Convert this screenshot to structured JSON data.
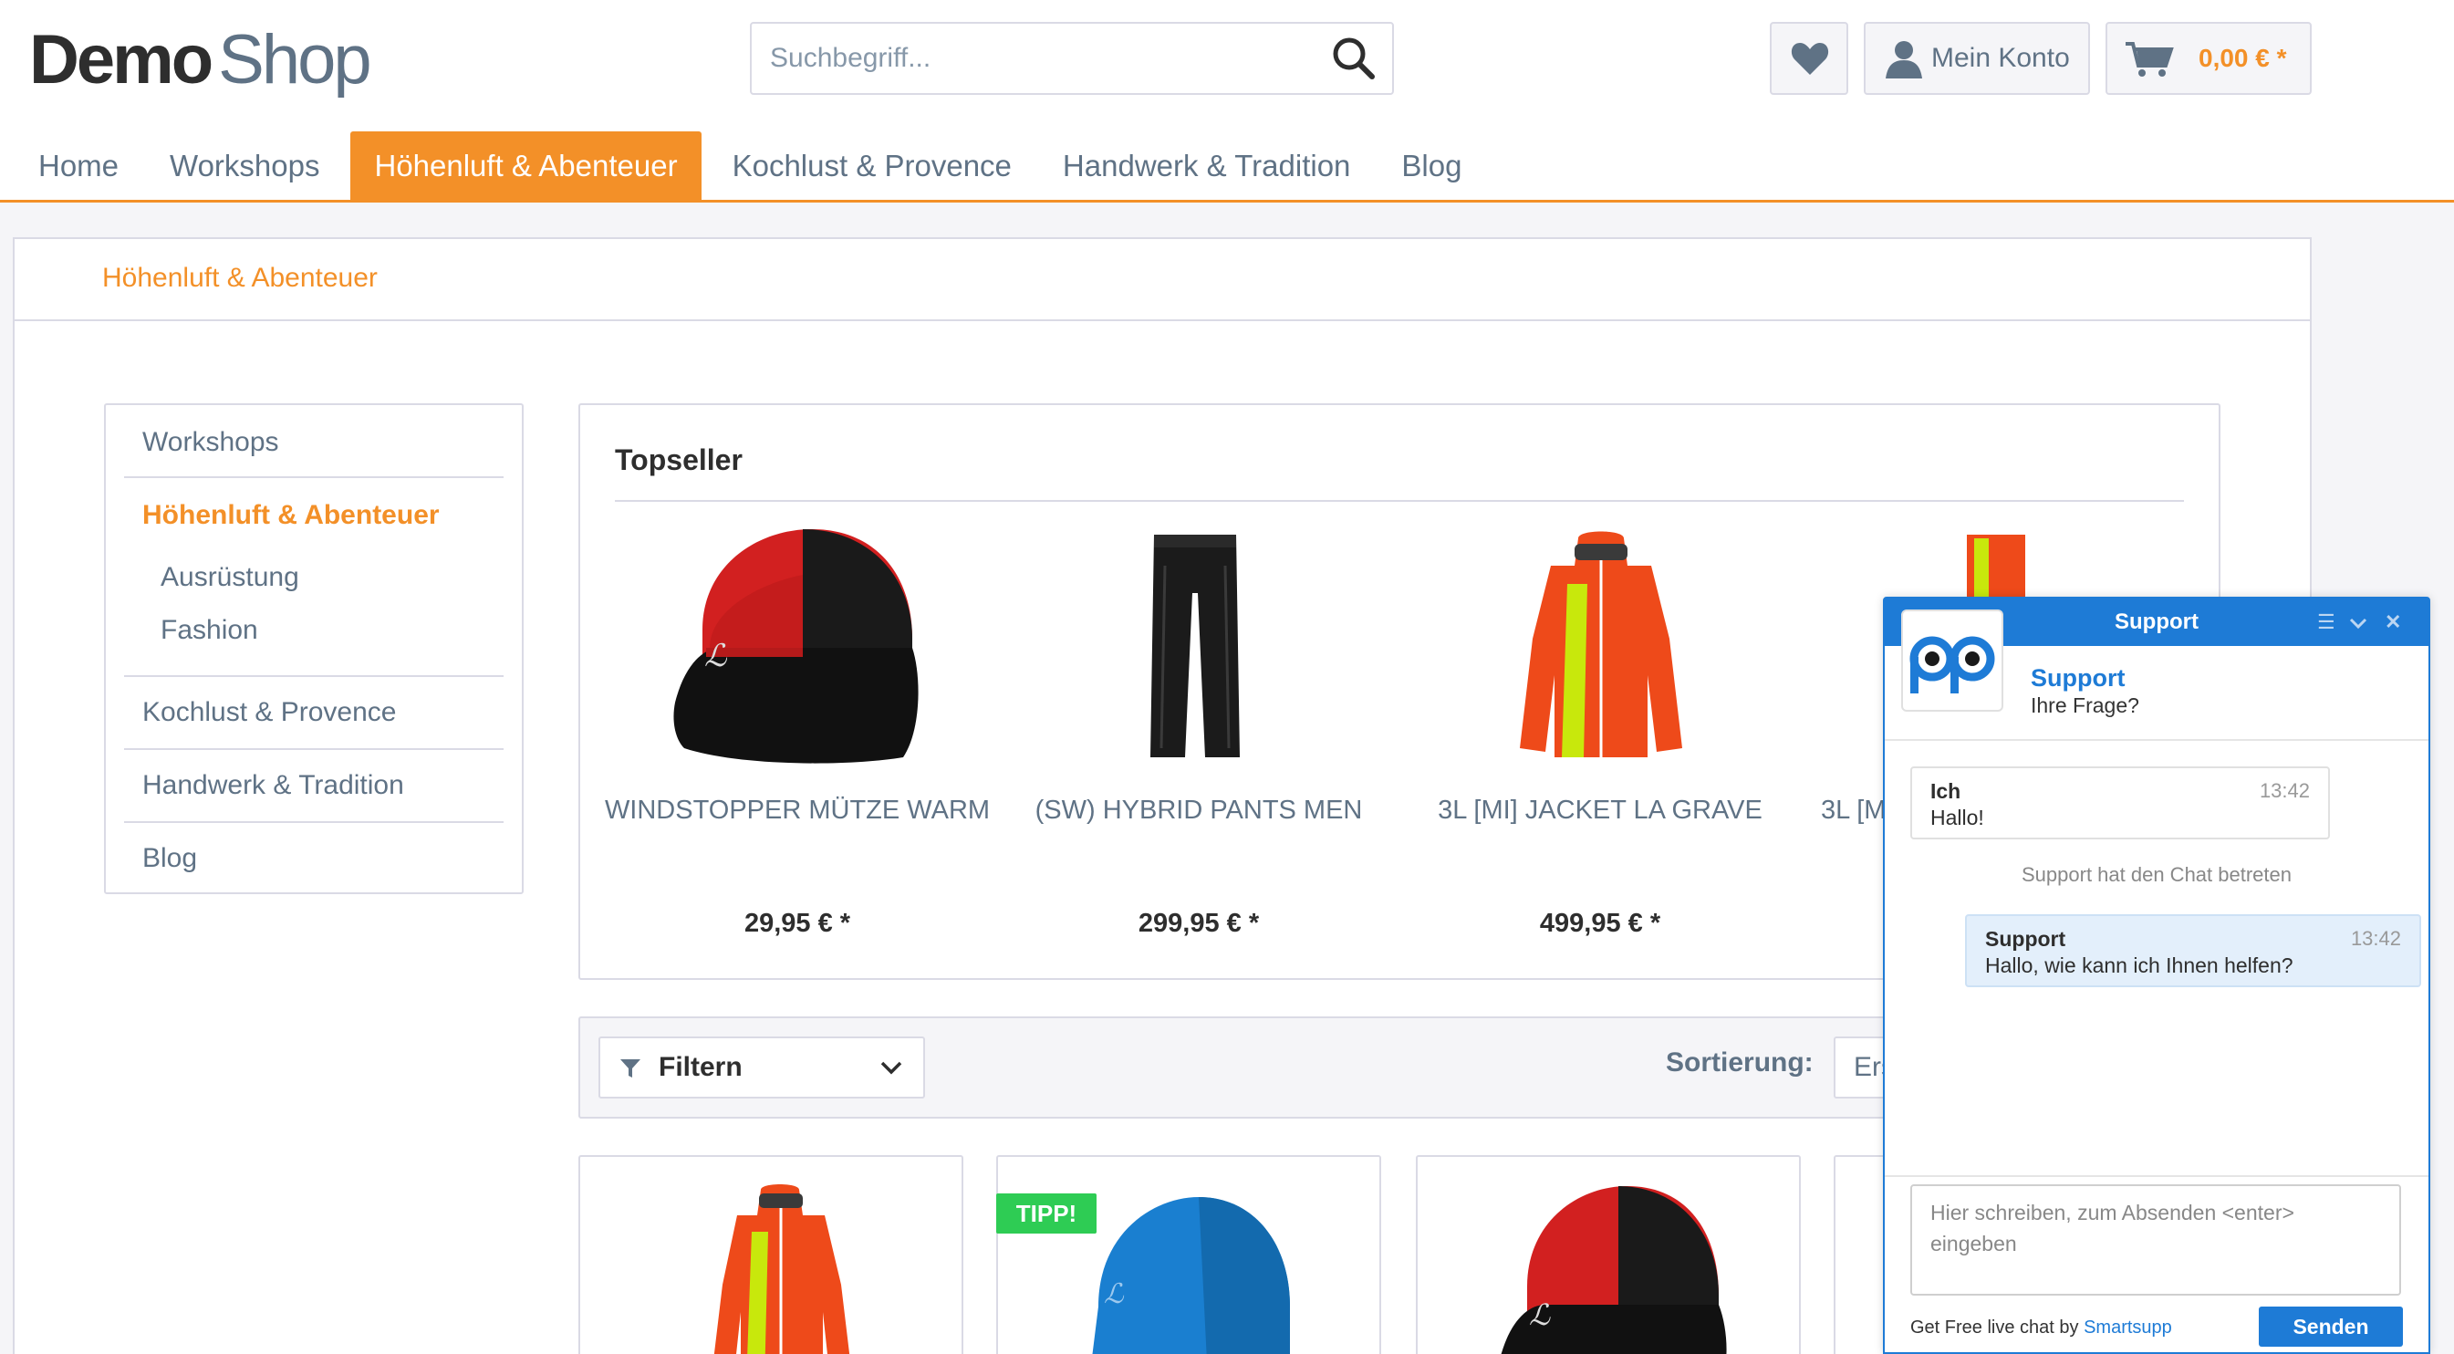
{
  "header": {
    "logo_demo": "Demo",
    "logo_shop": "Shop",
    "search_placeholder": "Suchbegriff...",
    "account_label": "Mein Konto",
    "cart_label": "0,00 € *"
  },
  "nav": [
    {
      "label": "Home"
    },
    {
      "label": "Workshops"
    },
    {
      "label": "Höhenluft & Abenteuer",
      "active": true
    },
    {
      "label": "Kochlust & Provence"
    },
    {
      "label": "Handwerk & Tradition"
    },
    {
      "label": "Blog"
    }
  ],
  "breadcrumb": "Höhenluft & Abenteuer",
  "sidebar": {
    "items": [
      {
        "label": "Workshops"
      },
      {
        "label": "Höhenluft & Abenteuer",
        "active": true
      },
      {
        "label": "Ausrüstung"
      },
      {
        "label": "Fashion"
      },
      {
        "label": "Kochlust & Provence"
      },
      {
        "label": "Handwerk & Tradition"
      },
      {
        "label": "Blog"
      }
    ]
  },
  "topseller": {
    "title": "Topseller",
    "products": [
      {
        "name": "WINDSTOPPER MÜTZE WARM",
        "price": "29,95 € *"
      },
      {
        "name": "(SW) HYBRID PANTS MEN",
        "price": "299,95 € *"
      },
      {
        "name": "3L [MI] JACKET LA GRAVE",
        "price": "499,95 € *"
      },
      {
        "name": "3L [M",
        "price": ""
      }
    ]
  },
  "listing": {
    "filter_label": "Filtern",
    "sort_label": "Sortierung:",
    "sort_value": "Ers",
    "tipp_badge": "TIPP!"
  },
  "chat": {
    "title": "Support",
    "agent_name": "Support",
    "agent_subtitle": "Ihre Frage?",
    "messages": [
      {
        "who": "Ich",
        "text": "Hallo!",
        "time": "13:42"
      },
      {
        "who": "Support",
        "text": "Hallo, wie kann ich Ihnen helfen?",
        "time": "13:42"
      }
    ],
    "join_notice": "Support hat den Chat betreten",
    "input_placeholder": "Hier schreiben, zum Absenden <enter> eingeben",
    "powered_prefix": "Get Free live chat by ",
    "powered_link": "Smartsupp",
    "send_label": "Senden"
  },
  "colors": {
    "accent": "#f39028",
    "chat_blue": "#1e7bd6",
    "tipp_green": "#2ecc54"
  }
}
